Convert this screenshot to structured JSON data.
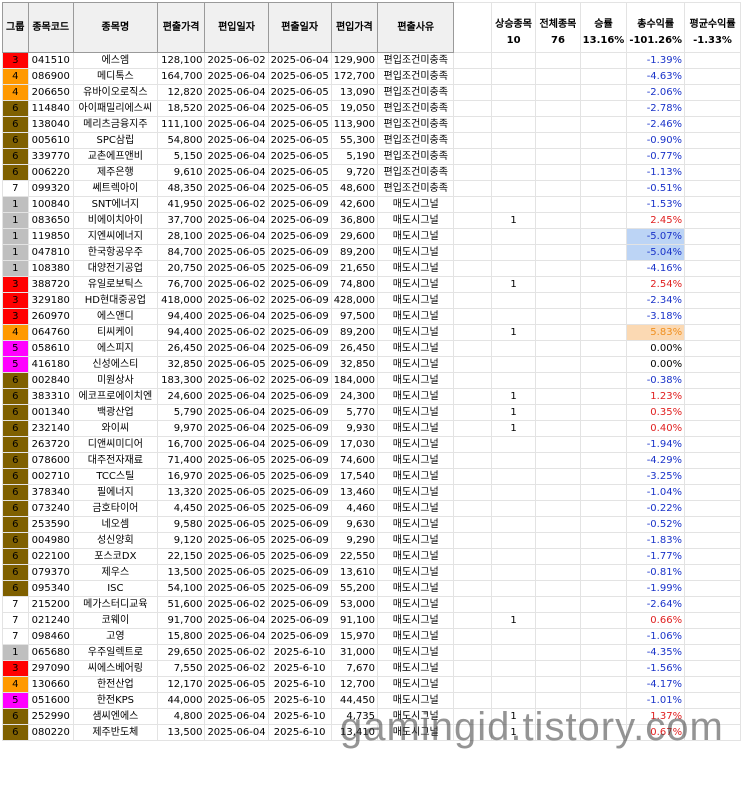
{
  "headers": {
    "group": "그룹",
    "code": "종목코드",
    "name": "종목명",
    "out_price": "편출가격",
    "in_date": "편입일자",
    "out_date": "편출일자",
    "in_price": "편입가격",
    "reason": "편출사유",
    "up_count": "상승종목",
    "total": "전체종목",
    "win_rate": "승률",
    "total_ret": "총수익률",
    "avg_ret": "평균수익률"
  },
  "summary": {
    "up_count": "10",
    "total": "76",
    "win_rate": "13.16%",
    "total_ret": "-101.26%",
    "avg_ret": "-1.33%"
  },
  "group_colors": {
    "1": "#bfbfbf",
    "3": "#ff0000",
    "4": "#ff9900",
    "5": "#ff00ff",
    "6": "#7f6000",
    "7": "#ffffff"
  },
  "rows": [
    {
      "g": "3",
      "code": "041510",
      "name": "에스엠",
      "out": "128,100",
      "d1": "2025-06-02",
      "d2": "2025-06-04",
      "inp": "129,900",
      "reason": "편입조건미충족",
      "up": "",
      "ret": "-1.39%",
      "s": "neg"
    },
    {
      "g": "4",
      "code": "086900",
      "name": "메디톡스",
      "out": "164,700",
      "d1": "2025-06-04",
      "d2": "2025-06-05",
      "inp": "172,700",
      "reason": "편입조건미충족",
      "up": "",
      "ret": "-4.63%",
      "s": "neg"
    },
    {
      "g": "4",
      "code": "206650",
      "name": "유바이오로직스",
      "out": "12,820",
      "d1": "2025-06-04",
      "d2": "2025-06-05",
      "inp": "13,090",
      "reason": "편입조건미충족",
      "up": "",
      "ret": "-2.06%",
      "s": "neg"
    },
    {
      "g": "6",
      "code": "114840",
      "name": "아이패밀리에스씨",
      "out": "18,520",
      "d1": "2025-06-04",
      "d2": "2025-06-05",
      "inp": "19,050",
      "reason": "편입조건미충족",
      "up": "",
      "ret": "-2.78%",
      "s": "neg"
    },
    {
      "g": "6",
      "code": "138040",
      "name": "메리츠금융지주",
      "out": "111,100",
      "d1": "2025-06-04",
      "d2": "2025-06-05",
      "inp": "113,900",
      "reason": "편입조건미충족",
      "up": "",
      "ret": "-2.46%",
      "s": "neg"
    },
    {
      "g": "6",
      "code": "005610",
      "name": "SPC삼립",
      "out": "54,800",
      "d1": "2025-06-04",
      "d2": "2025-06-05",
      "inp": "55,300",
      "reason": "편입조건미충족",
      "up": "",
      "ret": "-0.90%",
      "s": "neg"
    },
    {
      "g": "6",
      "code": "339770",
      "name": "교촌에프앤비",
      "out": "5,150",
      "d1": "2025-06-04",
      "d2": "2025-06-05",
      "inp": "5,190",
      "reason": "편입조건미충족",
      "up": "",
      "ret": "-0.77%",
      "s": "neg"
    },
    {
      "g": "6",
      "code": "006220",
      "name": "제주은행",
      "out": "9,610",
      "d1": "2025-06-04",
      "d2": "2025-06-05",
      "inp": "9,720",
      "reason": "편입조건미충족",
      "up": "",
      "ret": "-1.13%",
      "s": "neg"
    },
    {
      "g": "7",
      "code": "099320",
      "name": "쎄트렉아이",
      "out": "48,350",
      "d1": "2025-06-04",
      "d2": "2025-06-05",
      "inp": "48,600",
      "reason": "편입조건미충족",
      "up": "",
      "ret": "-0.51%",
      "s": "neg"
    },
    {
      "g": "1",
      "code": "100840",
      "name": "SNT에너지",
      "out": "41,950",
      "d1": "2025-06-02",
      "d2": "2025-06-09",
      "inp": "42,600",
      "reason": "매도시그널",
      "up": "",
      "ret": "-1.53%",
      "s": "neg",
      "sep": true
    },
    {
      "g": "1",
      "code": "083650",
      "name": "비에이치아이",
      "out": "37,700",
      "d1": "2025-06-04",
      "d2": "2025-06-09",
      "inp": "36,800",
      "reason": "매도시그널",
      "up": "1",
      "ret": "2.45%",
      "s": "pos"
    },
    {
      "g": "1",
      "code": "119850",
      "name": "지엔씨에너지",
      "out": "28,100",
      "d1": "2025-06-04",
      "d2": "2025-06-09",
      "inp": "29,600",
      "reason": "매도시그널",
      "up": "",
      "ret": "-5.07%",
      "s": "neg",
      "hl": "blue"
    },
    {
      "g": "1",
      "code": "047810",
      "name": "한국항공우주",
      "out": "84,700",
      "d1": "2025-06-05",
      "d2": "2025-06-09",
      "inp": "89,200",
      "reason": "매도시그널",
      "up": "",
      "ret": "-5.04%",
      "s": "neg",
      "hl": "blue"
    },
    {
      "g": "1",
      "code": "108380",
      "name": "대양전기공업",
      "out": "20,750",
      "d1": "2025-06-05",
      "d2": "2025-06-09",
      "inp": "21,650",
      "reason": "매도시그널",
      "up": "",
      "ret": "-4.16%",
      "s": "neg"
    },
    {
      "g": "3",
      "code": "388720",
      "name": "유일로보틱스",
      "out": "76,700",
      "d1": "2025-06-02",
      "d2": "2025-06-09",
      "inp": "74,800",
      "reason": "매도시그널",
      "up": "1",
      "ret": "2.54%",
      "s": "pos"
    },
    {
      "g": "3",
      "code": "329180",
      "name": "HD현대중공업",
      "out": "418,000",
      "d1": "2025-06-02",
      "d2": "2025-06-09",
      "inp": "428,000",
      "reason": "매도시그널",
      "up": "",
      "ret": "-2.34%",
      "s": "neg"
    },
    {
      "g": "3",
      "code": "260970",
      "name": "에스앤디",
      "out": "94,400",
      "d1": "2025-06-04",
      "d2": "2025-06-09",
      "inp": "97,500",
      "reason": "매도시그널",
      "up": "",
      "ret": "-3.18%",
      "s": "neg"
    },
    {
      "g": "4",
      "code": "064760",
      "name": "티씨케이",
      "out": "94,400",
      "d1": "2025-06-02",
      "d2": "2025-06-09",
      "inp": "89,200",
      "reason": "매도시그널",
      "up": "1",
      "ret": "5.83%",
      "s": "pos",
      "hl": "orange"
    },
    {
      "g": "5",
      "code": "058610",
      "name": "에스피지",
      "out": "26,450",
      "d1": "2025-06-04",
      "d2": "2025-06-09",
      "inp": "26,450",
      "reason": "매도시그널",
      "up": "",
      "ret": "0.00%",
      "s": "zero"
    },
    {
      "g": "5",
      "code": "416180",
      "name": "신성에스티",
      "out": "32,850",
      "d1": "2025-06-05",
      "d2": "2025-06-09",
      "inp": "32,850",
      "reason": "매도시그널",
      "up": "",
      "ret": "0.00%",
      "s": "zero"
    },
    {
      "g": "6",
      "code": "002840",
      "name": "미원상사",
      "out": "183,300",
      "d1": "2025-06-02",
      "d2": "2025-06-09",
      "inp": "184,000",
      "reason": "매도시그널",
      "up": "",
      "ret": "-0.38%",
      "s": "neg"
    },
    {
      "g": "6",
      "code": "383310",
      "name": "에코프로에이치엔",
      "out": "24,600",
      "d1": "2025-06-04",
      "d2": "2025-06-09",
      "inp": "24,300",
      "reason": "매도시그널",
      "up": "1",
      "ret": "1.23%",
      "s": "pos"
    },
    {
      "g": "6",
      "code": "001340",
      "name": "백광산업",
      "out": "5,790",
      "d1": "2025-06-04",
      "d2": "2025-06-09",
      "inp": "5,770",
      "reason": "매도시그널",
      "up": "1",
      "ret": "0.35%",
      "s": "pos"
    },
    {
      "g": "6",
      "code": "232140",
      "name": "와이씨",
      "out": "9,970",
      "d1": "2025-06-04",
      "d2": "2025-06-09",
      "inp": "9,930",
      "reason": "매도시그널",
      "up": "1",
      "ret": "0.40%",
      "s": "pos"
    },
    {
      "g": "6",
      "code": "263720",
      "name": "디앤씨미디어",
      "out": "16,700",
      "d1": "2025-06-04",
      "d2": "2025-06-09",
      "inp": "17,030",
      "reason": "매도시그널",
      "up": "",
      "ret": "-1.94%",
      "s": "neg"
    },
    {
      "g": "6",
      "code": "078600",
      "name": "대주전자재료",
      "out": "71,400",
      "d1": "2025-06-05",
      "d2": "2025-06-09",
      "inp": "74,600",
      "reason": "매도시그널",
      "up": "",
      "ret": "-4.29%",
      "s": "neg"
    },
    {
      "g": "6",
      "code": "002710",
      "name": "TCC스틸",
      "out": "16,970",
      "d1": "2025-06-05",
      "d2": "2025-06-09",
      "inp": "17,540",
      "reason": "매도시그널",
      "up": "",
      "ret": "-3.25%",
      "s": "neg"
    },
    {
      "g": "6",
      "code": "378340",
      "name": "필에너지",
      "out": "13,320",
      "d1": "2025-06-05",
      "d2": "2025-06-09",
      "inp": "13,460",
      "reason": "매도시그널",
      "up": "",
      "ret": "-1.04%",
      "s": "neg"
    },
    {
      "g": "6",
      "code": "073240",
      "name": "금호타이어",
      "out": "4,450",
      "d1": "2025-06-05",
      "d2": "2025-06-09",
      "inp": "4,460",
      "reason": "매도시그널",
      "up": "",
      "ret": "-0.22%",
      "s": "neg"
    },
    {
      "g": "6",
      "code": "253590",
      "name": "네오셈",
      "out": "9,580",
      "d1": "2025-06-05",
      "d2": "2025-06-09",
      "inp": "9,630",
      "reason": "매도시그널",
      "up": "",
      "ret": "-0.52%",
      "s": "neg"
    },
    {
      "g": "6",
      "code": "004980",
      "name": "성신양회",
      "out": "9,120",
      "d1": "2025-06-05",
      "d2": "2025-06-09",
      "inp": "9,290",
      "reason": "매도시그널",
      "up": "",
      "ret": "-1.83%",
      "s": "neg"
    },
    {
      "g": "6",
      "code": "022100",
      "name": "포스코DX",
      "out": "22,150",
      "d1": "2025-06-05",
      "d2": "2025-06-09",
      "inp": "22,550",
      "reason": "매도시그널",
      "up": "",
      "ret": "-1.77%",
      "s": "neg"
    },
    {
      "g": "6",
      "code": "079370",
      "name": "제우스",
      "out": "13,500",
      "d1": "2025-06-05",
      "d2": "2025-06-09",
      "inp": "13,610",
      "reason": "매도시그널",
      "up": "",
      "ret": "-0.81%",
      "s": "neg"
    },
    {
      "g": "6",
      "code": "095340",
      "name": "ISC",
      "out": "54,100",
      "d1": "2025-06-05",
      "d2": "2025-06-09",
      "inp": "55,200",
      "reason": "매도시그널",
      "up": "",
      "ret": "-1.99%",
      "s": "neg"
    },
    {
      "g": "7",
      "code": "215200",
      "name": "메가스터디교육",
      "out": "51,600",
      "d1": "2025-06-02",
      "d2": "2025-06-09",
      "inp": "53,000",
      "reason": "매도시그널",
      "up": "",
      "ret": "-2.64%",
      "s": "neg"
    },
    {
      "g": "7",
      "code": "021240",
      "name": "코웨이",
      "out": "91,700",
      "d1": "2025-06-04",
      "d2": "2025-06-09",
      "inp": "91,100",
      "reason": "매도시그널",
      "up": "1",
      "ret": "0.66%",
      "s": "pos"
    },
    {
      "g": "7",
      "code": "098460",
      "name": "고영",
      "out": "15,800",
      "d1": "2025-06-04",
      "d2": "2025-06-09",
      "inp": "15,970",
      "reason": "매도시그널",
      "up": "",
      "ret": "-1.06%",
      "s": "neg"
    },
    {
      "g": "1",
      "code": "065680",
      "name": "우주일렉트로",
      "out": "29,650",
      "d1": "2025-06-02",
      "d2": "2025-6-10",
      "inp": "31,000",
      "reason": "매도시그널",
      "up": "",
      "ret": "-4.35%",
      "s": "neg",
      "sep": true
    },
    {
      "g": "3",
      "code": "297090",
      "name": "씨에스베어링",
      "out": "7,550",
      "d1": "2025-06-02",
      "d2": "2025-6-10",
      "inp": "7,670",
      "reason": "매도시그널",
      "up": "",
      "ret": "-1.56%",
      "s": "neg"
    },
    {
      "g": "4",
      "code": "130660",
      "name": "한전산업",
      "out": "12,170",
      "d1": "2025-06-05",
      "d2": "2025-6-10",
      "inp": "12,700",
      "reason": "매도시그널",
      "up": "",
      "ret": "-4.17%",
      "s": "neg"
    },
    {
      "g": "5",
      "code": "051600",
      "name": "한전KPS",
      "out": "44,000",
      "d1": "2025-06-05",
      "d2": "2025-6-10",
      "inp": "44,450",
      "reason": "매도시그널",
      "up": "",
      "ret": "-1.01%",
      "s": "neg"
    },
    {
      "g": "6",
      "code": "252990",
      "name": "샘씨엔에스",
      "out": "4,800",
      "d1": "2025-06-04",
      "d2": "2025-6-10",
      "inp": "4,735",
      "reason": "매도시그널",
      "up": "1",
      "ret": "1.37%",
      "s": "pos"
    },
    {
      "g": "6",
      "code": "080220",
      "name": "제주반도체",
      "out": "13,500",
      "d1": "2025-06-04",
      "d2": "2025-6-10",
      "inp": "13,410",
      "reason": "매도시그널",
      "up": "1",
      "ret": "0.67%",
      "s": "pos"
    }
  ],
  "watermark": "gamingid.tistory.com"
}
